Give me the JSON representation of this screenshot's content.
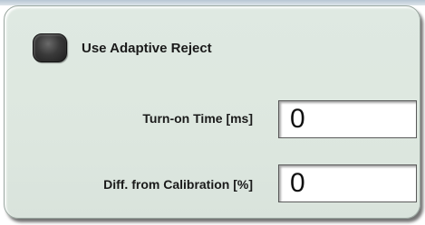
{
  "panel": {
    "adaptive_reject": {
      "label": "Use Adaptive Reject",
      "checked": false
    },
    "turn_on_time": {
      "label": "Turn-on Time [ms]",
      "value": "0"
    },
    "diff_from_calibration": {
      "label": "Diff. from Calibration [%]",
      "value": "0"
    }
  },
  "colors": {
    "panel_background": "#dde7df",
    "checkbox_fill": "#3a3a3a"
  }
}
